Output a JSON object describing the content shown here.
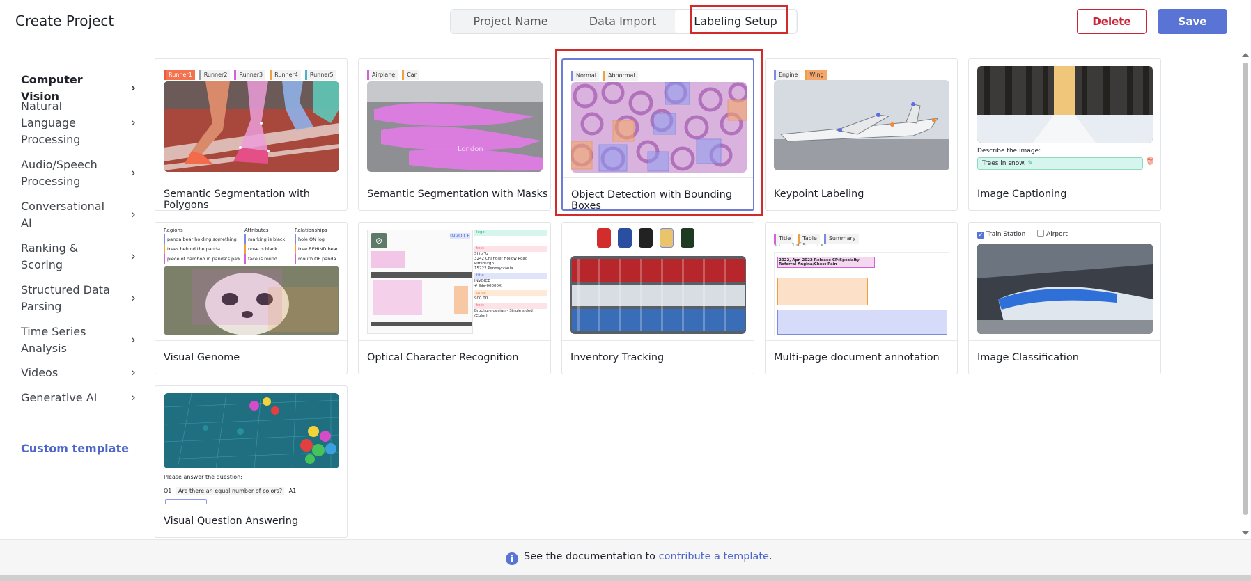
{
  "header": {
    "title": "Create Project",
    "tabs": [
      "Project Name",
      "Data Import",
      "Labeling Setup"
    ],
    "delete_label": "Delete",
    "save_label": "Save"
  },
  "sidebar": {
    "items": [
      "Computer Vision",
      "Natural Language Processing",
      "Audio/Speech Processing",
      "Conversational AI",
      "Ranking & Scoring",
      "Structured Data Parsing",
      "Time Series Analysis",
      "Videos",
      "Generative AI"
    ],
    "custom_template": "Custom template"
  },
  "templates": [
    {
      "name": "Semantic Segmentation with Polygons",
      "chips": [
        "Runner1",
        "Runner2",
        "Runner3",
        "Runner4",
        "Runner5"
      ]
    },
    {
      "name": "Semantic Segmentation with Masks",
      "chips": [
        "Airplane",
        "Car"
      ]
    },
    {
      "name": "Object Detection with Bounding Boxes",
      "chips": [
        "Normal",
        "Abnormal"
      ]
    },
    {
      "name": "Keypoint Labeling",
      "chips": [
        "Engine",
        "Wing"
      ]
    },
    {
      "name": "Image Captioning",
      "describe": "Describe the image:",
      "caption": "Trees in snow."
    },
    {
      "name": "Visual Genome",
      "col_headers": [
        "Regions",
        "Attributes",
        "Relationships"
      ],
      "regions": [
        "panda bear holding something",
        "trees behind the panda",
        "piece of bamboo in panda's paw"
      ],
      "attributes": [
        "marking is black",
        "nose is black",
        "face is round"
      ],
      "relationships": [
        "hole ON log",
        "tree BEHIND bear",
        "mouth OF panda"
      ]
    },
    {
      "name": "Optical Character Recognition",
      "invoice_word": "INVOICE",
      "ship_to": [
        "Ship To",
        "3242 Chandler Hollow Road",
        "Pittsburgh",
        "15222 Pennsylvania"
      ],
      "invoice_no": [
        "INVOICE",
        "# INV-00000X"
      ],
      "amount": "900.00",
      "brochure": "Brochure design - Single sided (Color)",
      "field_tags": [
        "logo",
        "text",
        "title",
        "price",
        "text"
      ]
    },
    {
      "name": "Inventory Tracking"
    },
    {
      "name": "Multi-page document annotation",
      "chips": [
        "Title",
        "Table",
        "Summary"
      ],
      "pager": "1 of 9",
      "doc_title": "2022, Apr. 2022 Release CP:Specialty Referral Angina/Chest Pain"
    },
    {
      "name": "Image Classification",
      "options": [
        "Train Station",
        "Airport"
      ]
    },
    {
      "name": "Visual Question Answering",
      "prompt": "Please answer the question:",
      "q_label": "Q1",
      "question": "Are there an equal number of colors?",
      "a_label": "A1"
    }
  ],
  "footer": {
    "text": "See the documentation to ",
    "link": "contribute a template",
    "suffix": "."
  },
  "colors": {
    "accent": "#5a74d6",
    "delete": "#c8263b",
    "highlight": "#d12b2b",
    "link": "#4e66c9"
  }
}
